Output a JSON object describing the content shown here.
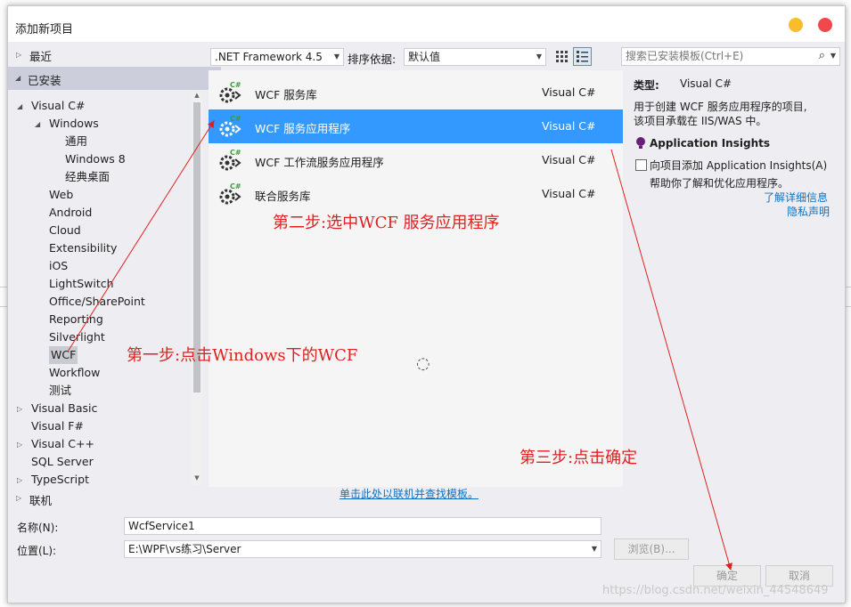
{
  "dialog": {
    "title": "添加新项目"
  },
  "tree": {
    "recent": "最近",
    "installed": "已安装",
    "items": [
      {
        "label": "Visual C#",
        "indent": 1,
        "expander": "open"
      },
      {
        "label": "Windows",
        "indent": 2,
        "expander": "open"
      },
      {
        "label": "通用",
        "indent": 3,
        "expander": ""
      },
      {
        "label": "Windows 8",
        "indent": 3,
        "expander": ""
      },
      {
        "label": "经典桌面",
        "indent": 3,
        "expander": ""
      },
      {
        "label": "Web",
        "indent": 2,
        "expander": ""
      },
      {
        "label": "Android",
        "indent": 2,
        "expander": ""
      },
      {
        "label": "Cloud",
        "indent": 2,
        "expander": ""
      },
      {
        "label": "Extensibility",
        "indent": 2,
        "expander": ""
      },
      {
        "label": "iOS",
        "indent": 2,
        "expander": ""
      },
      {
        "label": "LightSwitch",
        "indent": 2,
        "expander": ""
      },
      {
        "label": "Office/SharePoint",
        "indent": 2,
        "expander": ""
      },
      {
        "label": "Reporting",
        "indent": 2,
        "expander": ""
      },
      {
        "label": "Silverlight",
        "indent": 2,
        "expander": ""
      },
      {
        "label": "WCF",
        "indent": 2,
        "expander": ""
      },
      {
        "label": "Workflow",
        "indent": 2,
        "expander": ""
      },
      {
        "label": "测试",
        "indent": 2,
        "expander": ""
      },
      {
        "label": "Visual Basic",
        "indent": 1,
        "expander": "closed"
      },
      {
        "label": "Visual F#",
        "indent": 1,
        "expander": ""
      },
      {
        "label": "Visual C++",
        "indent": 1,
        "expander": "closed"
      },
      {
        "label": "SQL Server",
        "indent": 1,
        "expander": ""
      },
      {
        "label": "TypeScript",
        "indent": 1,
        "expander": "closed"
      }
    ],
    "online": "联机"
  },
  "toolbar": {
    "framework": ".NET Framework 4.5",
    "sort_label": "排序依据:",
    "sort_value": "默认值",
    "search_placeholder": "搜索已安装模板(Ctrl+E)"
  },
  "templates": [
    {
      "name": "WCF 服务库",
      "lang": "Visual C#",
      "selected": false
    },
    {
      "name": "WCF 服务应用程序",
      "lang": "Visual C#",
      "selected": true
    },
    {
      "name": "WCF 工作流服务应用程序",
      "lang": "Visual C#",
      "selected": false
    },
    {
      "name": "联合服务库",
      "lang": "Visual C#",
      "selected": false
    }
  ],
  "online_link": "单击此处以联机并查找模板。",
  "details": {
    "type_label": "类型:",
    "type_value": "Visual C#",
    "description_line1": "用于创建 WCF 服务应用程序的项目,",
    "description_line2": "该项目承载在 IIS/WAS 中。",
    "insights_title": "Application Insights",
    "insights_checkbox": "向项目添加 Application Insights(A)",
    "insights_help": "帮助你了解和优化应用程序。",
    "learn_more": "了解详细信息",
    "privacy": "隐私声明"
  },
  "form": {
    "name_label": "名称(N):",
    "name_value": "WcfService1",
    "location_label": "位置(L):",
    "location_value": "E:\\WPF\\vs练习\\Server",
    "browse": "浏览(B)...",
    "ok": "确定",
    "cancel": "取消"
  },
  "annotations": {
    "step1": "第一步:点击Windows下的WCF",
    "step2": "第二步:选中WCF 服务应用程序",
    "step3": "第三步:点击确定"
  },
  "watermark": "https://blog.csdn.net/weixin_44548649",
  "colors": {
    "selected": "#3399ff",
    "annotation": "#e02020",
    "link": "#0e70c0"
  }
}
